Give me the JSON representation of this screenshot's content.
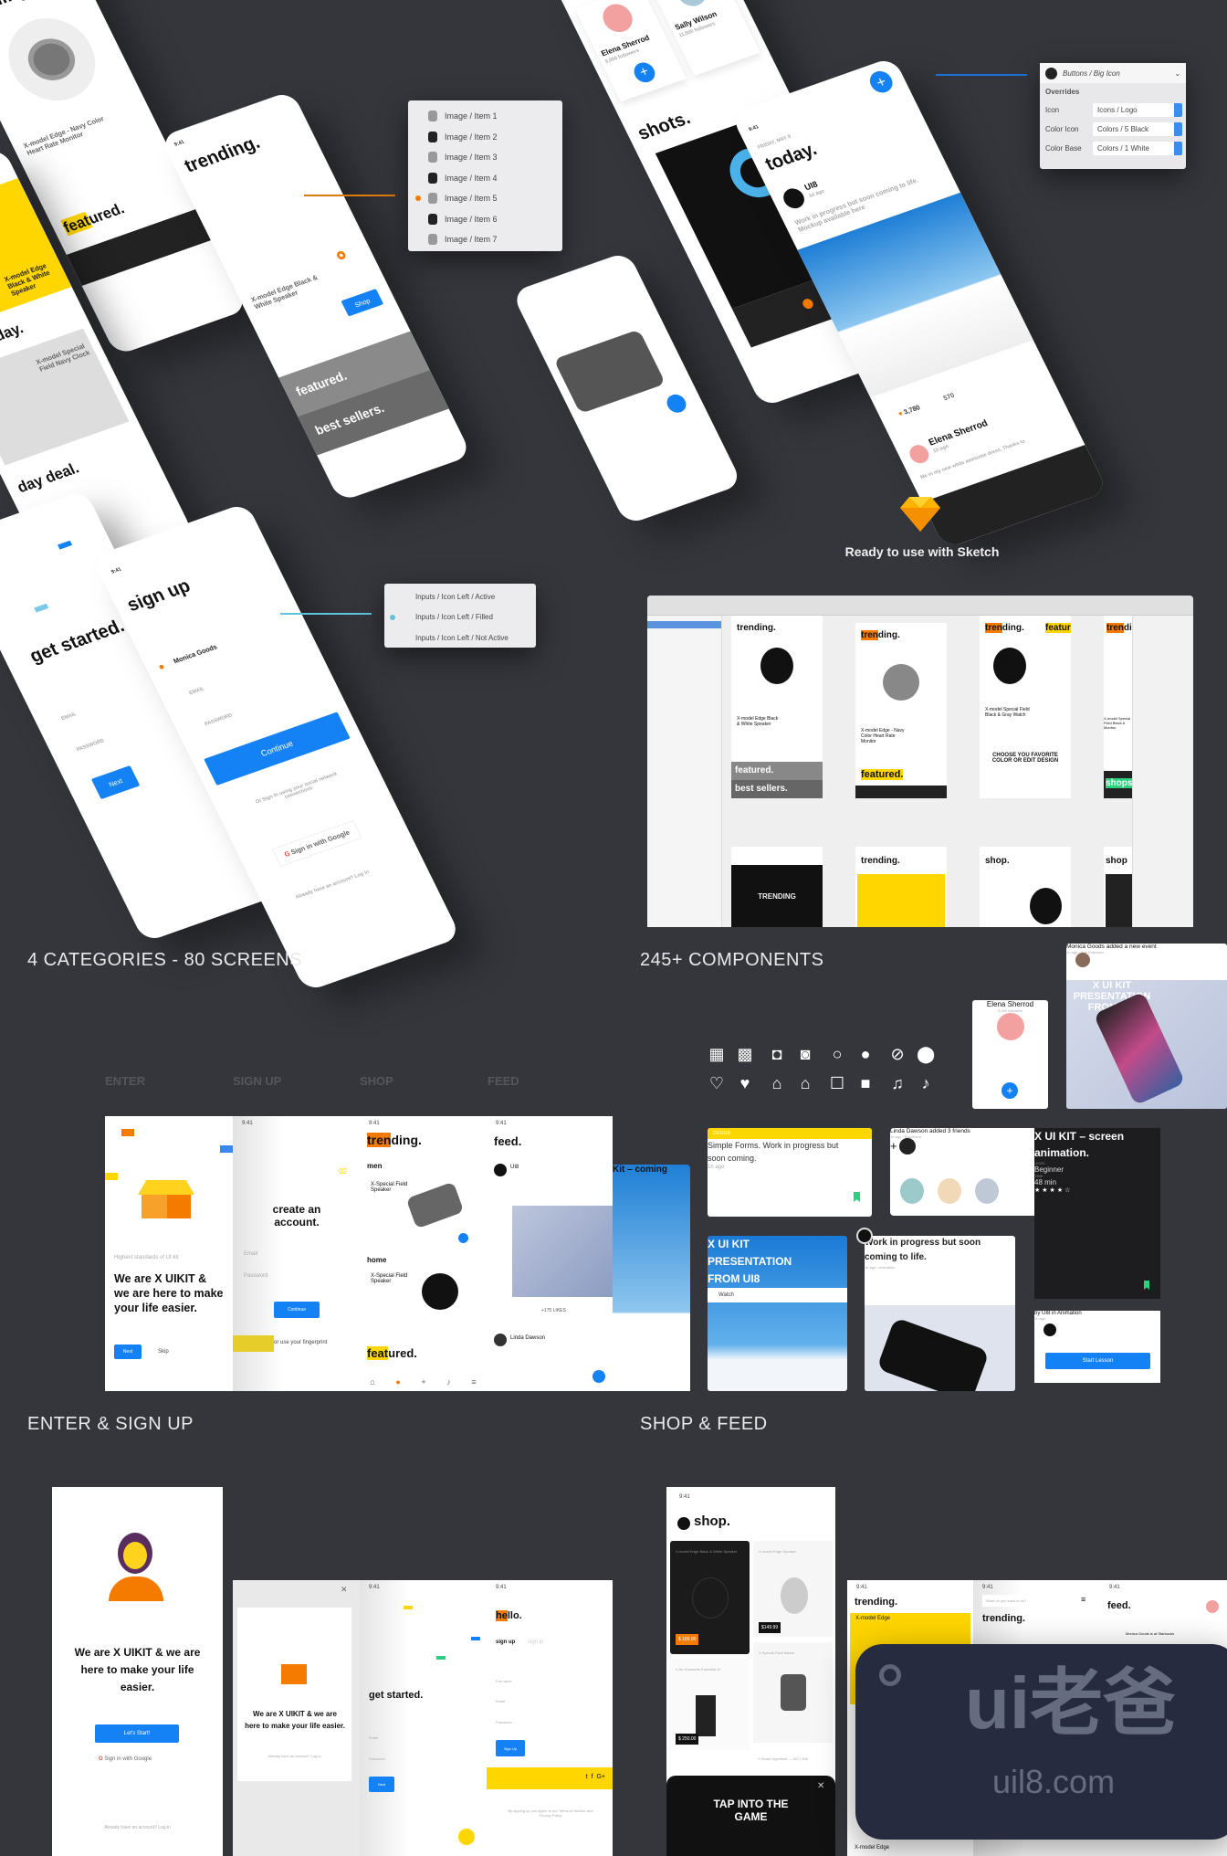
{
  "top_left": {
    "phone_a": {
      "title_hl": "tren",
      "title_rest": "ding.",
      "product": "X-model Edge - Navy Color Heart Rate Monitor",
      "featured_hl": "feat",
      "featured_rest": "ured."
    },
    "phone_b": {
      "product_a": "X-model Edge Black & White Speaker",
      "new_today": "new today.",
      "product_b": "X-model Special Field Navy Clock",
      "day_deal": "day deal."
    },
    "phone_c": {
      "time": "9:41",
      "title": "trending.",
      "product": "X-model Edge Black & White Speaker",
      "shop_button": "Shop",
      "featured": "featured.",
      "best_sellers": "best sellers."
    },
    "image_popup": {
      "items": [
        "Image / Item 1",
        "Image / Item 2",
        "Image / Item 3",
        "Image / Item 4",
        "Image / Item 5",
        "Image / Item 6",
        "Image / Item 7"
      ],
      "selected_index": 4
    }
  },
  "top_right": {
    "profiles": {
      "people": [
        {
          "name": "Elena Sherrod",
          "followers": "5,000 followers"
        },
        {
          "name": "Sally Wilson",
          "followers": "11,500 followers"
        }
      ],
      "shots": "shots."
    },
    "today_phone": {
      "time": "9:41",
      "date": "FRIDAY, MAY 5",
      "title": "today.",
      "author": "UI8",
      "author_time": "1d ago",
      "post": "Work in progress but soon coming to life. Mockup available here",
      "likes": "3,780",
      "comments": "570",
      "commenter": "Elena Sherrod",
      "commenter_time": "1h ago",
      "comment": "Me in my new white awesome dress. Thanks to"
    },
    "override_panel": {
      "title": "Buttons / Big Icon",
      "section": "Overrides",
      "rows": [
        {
          "label": "Icon",
          "value": "Icons / Logo"
        },
        {
          "label": "Color Icon",
          "value": "Colors / 5 Black"
        },
        {
          "label": "Color Base",
          "value": "Colors / 1 White"
        }
      ]
    }
  },
  "signup": {
    "get_started": {
      "title": "get started.",
      "email": "EMAIL",
      "password": "PASSWORD",
      "next": "Next"
    },
    "sign_up": {
      "time": "9:41",
      "title": "sign up",
      "name_value": "Monica Goods",
      "email": "EMAIL",
      "password": "PASSWORD",
      "continue": "Continue",
      "social_text": "Or Sign In using your social network connections",
      "google": "Sign in with Google",
      "login_text": "Already have an account? Log in"
    },
    "inputs_popup": {
      "items": [
        "Inputs / Icon Left / Active",
        "Inputs / Icon Left / Filled",
        "Inputs / Icon Left / Not Active"
      ],
      "selected_index": 1
    }
  },
  "sketch": {
    "tagline": "Ready to use with Sketch",
    "artboards": [
      {
        "title": "trending.",
        "product": "X-model Edge Black & White Speaker",
        "extra_a": "featured.",
        "extra_b": "best sellers."
      },
      {
        "title_hl": "tren",
        "title_rest": "ding.",
        "product": "X-model Edge - Navy Color Heart Rate Monitor",
        "extra_a": "featured."
      },
      {
        "title_hl": "tren",
        "title_rest": "ding.",
        "title2": "featur",
        "product": "X-model Special Field Black & Gray Watch",
        "promo": "CHOOSE YOU FAVORITE COLOR OR EDIT DESIGN"
      },
      {
        "title_hl": "tren",
        "title_rest": "din",
        "product": "X-model Special Field Black & Monitor",
        "extra_a": "shops."
      }
    ],
    "row2": [
      "TRENDING",
      "trending.",
      "shop.",
      "shop"
    ]
  },
  "headings": {
    "categories": "4 CATEGORIES - 80 SCREENS",
    "components": "245+ COMPONENTS",
    "enter_signup": "ENTER & SIGN UP",
    "shop_feed": "SHOP & FEED"
  },
  "category_tabs": [
    "ENTER",
    "SIGN UP",
    "SHOP",
    "FEED"
  ],
  "category_screens": {
    "enter": {
      "small": "Highest standards of UI kit",
      "headline": "We are X UIKIT & we are here to make your life easier.",
      "next": "Next",
      "skip": "Skip"
    },
    "signup": {
      "time": "9:41",
      "step": "02",
      "title": "create an account.",
      "email": "Email",
      "password": "Password",
      "continue": "Continue",
      "fingerprint": "or use your fingerprint"
    },
    "shop": {
      "time": "9:41",
      "title_hl": "tren",
      "title_rest": "ding.",
      "men": "men",
      "product_a": "X-Special Field Speaker",
      "home": "home",
      "product_b": "X-Special Field Speaker",
      "featured_hl": "feat",
      "featured_rest": "ured."
    },
    "feed": {
      "time": "9:41",
      "title": "feed.",
      "author": "UI8",
      "likes": "+175 LIKES",
      "commenter": "Linda Dawson"
    }
  },
  "components": {
    "icons": [
      "calendar-outline",
      "calendar-filled",
      "camera-outline",
      "camera-filled",
      "chat-outline",
      "chat-filled",
      "compass-outline",
      "compass-filled",
      "heart-outline",
      "heart-filled",
      "home-outline",
      "home-filled",
      "lock-outline",
      "lock-filled",
      "bell-outline",
      "bell-filled"
    ],
    "profile_card": {
      "name": "Elena Sherrod",
      "followers": "5,000 followers"
    },
    "event_card": {
      "text": "Monica Goods added a new event",
      "meta": "1h ago • San Francisco",
      "overlay": "X UI KIT PRESENTATION FROM UI8"
    },
    "kit_card": {
      "caption": "Kit – coming"
    },
    "forms_card": {
      "tag": "DESIGN",
      "text": "Simple Forms. Work in progress but soon coming.",
      "time": "1h ago"
    },
    "friends_card": {
      "text": "Linda Dawson added 3 friends",
      "meta": "1h ago • Barcelona"
    },
    "lesson_card": {
      "title": "X UI KIT – screen animation.",
      "level_label": "LEVEL",
      "level": "Beginner",
      "time_label": "TIME",
      "time": "48 min",
      "rating": 4,
      "by": "by UI8 in Animation",
      "ago": "1h ago",
      "button": "Start Lesson"
    },
    "presentation_card": {
      "title": "X UI KIT PRESENTATION FROM UI8",
      "button": "Watch"
    },
    "progress_card": {
      "title": "Work in progress but soon coming to life.",
      "meta": "1h ago • Animation"
    }
  },
  "enter_screens": {
    "main": {
      "headline": "We are X UIKIT & we are here to make your life easier.",
      "start": "Let's Start!",
      "google": "Sign in with Google",
      "login": "Already have an account? Log in"
    },
    "modal": {
      "headline": "We are X UIKIT & we are here to make your life easier.",
      "login": "Already have an account? Log in"
    },
    "get_started": {
      "time": "9:41",
      "title": "get started.",
      "email": "Email",
      "password": "Password",
      "next": "Next"
    },
    "hello": {
      "time": "9:41",
      "title_hl": "he",
      "title_rest": "llo.",
      "tab_active": "sign up",
      "tab_inactive": "sign in",
      "full_name": "Full name",
      "email": "Email",
      "password": "Password",
      "button": "Sign Up",
      "terms": "By signing up you agree to our Terms of Service and Privacy Policy"
    }
  },
  "shop_screens": {
    "shop": {
      "time": "9:41",
      "title": "shop.",
      "items": [
        {
          "name": "X-model Edge Black & White Speaker",
          "price": "$ 189.90"
        },
        {
          "name": "X-model Edge Speaker",
          "price": "$149.99"
        },
        {
          "name": "X Air Huarache Essential ID",
          "price": "$ 250.00"
        },
        {
          "name": "X Special Field Watch",
          "price": ""
        },
        {
          "name": "X React Hyperknit — 2017 Mid",
          "price": ""
        }
      ],
      "promo": "TAP INTO THE GAME"
    },
    "trending": {
      "time": "9:41",
      "title": "trending.",
      "product": "X-model Edge",
      "bottom": "X-model Edge"
    },
    "search": {
      "time": "9:41",
      "placeholder": "What do you want to do?",
      "title": "trending."
    },
    "feed": {
      "time": "9:41",
      "title": "feed.",
      "post": "Monica Goods is at Starbucks"
    }
  },
  "watermark": {
    "logo": "ui老爸",
    "url": "uil8.com"
  },
  "colors": {
    "background": "#35363c",
    "accent_blue": "#1482f5",
    "orange": "#f47b00",
    "yellow": "#ffd600"
  }
}
